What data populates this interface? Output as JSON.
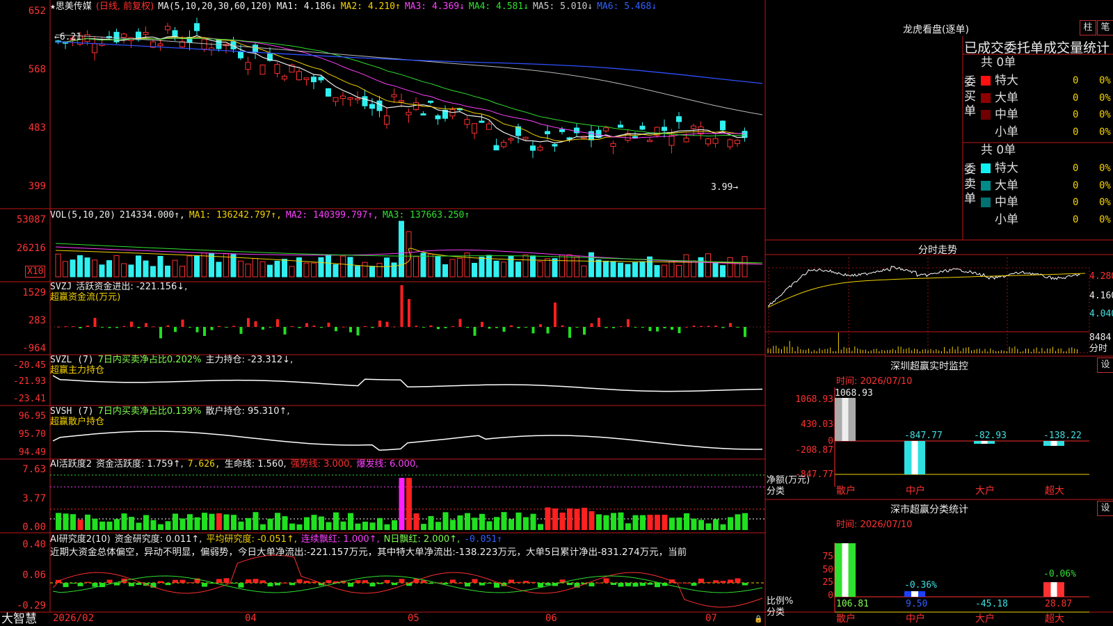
{
  "stock": {
    "name": "思美传媒",
    "period": "(日线, 前复权)",
    "ma_label": "MA(5,10,20,30,60,120)",
    "ma_values": [
      {
        "label": "MA1:",
        "value": "4.186",
        "arrow": "↓",
        "color": "#eeeeee"
      },
      {
        "label": "MA2:",
        "value": "4.210",
        "arrow": "↑",
        "color": "#f5d300"
      },
      {
        "label": "MA3:",
        "value": "4.369",
        "arrow": "↓",
        "color": "#ff40ff"
      },
      {
        "label": "MA4:",
        "value": "4.581",
        "arrow": "↓",
        "color": "#30e030"
      },
      {
        "label": "MA5:",
        "value": "5.010",
        "arrow": "↓",
        "color": "#cccccc"
      },
      {
        "label": "MA6:",
        "value": "5.468",
        "arrow": "↓",
        "color": "#3060ff"
      }
    ],
    "price_axis": [
      "652",
      "568",
      "483",
      "399"
    ],
    "high_label": "6.21",
    "low_label": "3.99→"
  },
  "vol": {
    "label": "VOL(5,10,20)",
    "value": "214334.000↑,",
    "ma1": "MA1: 136242.797↑,",
    "ma2": "MA2: 140399.797↑,",
    "ma3": "MA3: 137663.250↑",
    "axis": [
      "53087",
      "26216"
    ],
    "unit": "X10"
  },
  "svzj": {
    "label": "SVZJ",
    "desc": "活跃资金进出: -221.156↓,",
    "sub": "超赢资金流(万元)",
    "axis": [
      "1529",
      "283",
      "-964"
    ]
  },
  "svzl": {
    "label": "SVZL (7)",
    "desc": "7日内买卖净占比0.202%",
    "hold": "主力持仓: -23.312↓,",
    "sub": "超赢主力持仓",
    "axis": [
      "-20.45",
      "-21.93",
      "-23.41"
    ]
  },
  "svsh": {
    "label": "SVSH (7)",
    "desc": "7日内买卖净占比0.139%",
    "hold": "散户持仓: 95.310↑,",
    "sub": "超赢散户持仓",
    "axis": [
      "96.95",
      "95.70",
      "94.49"
    ]
  },
  "ai1": {
    "label": "AI活跃度2",
    "a": "资金活跃度: 1.759↑,",
    "b": "7.626,",
    "c": "生命线: 1.560,",
    "d": "强势线: 3.000,",
    "e": "爆发线: 6.000,",
    "axis": [
      "7.63",
      "3.77",
      "0.00"
    ]
  },
  "ai2": {
    "label": "AI研究度2(10)",
    "a": "资金研究度: 0.011↑,",
    "b": "平均研究度: -0.051↑,",
    "c": "连续飘红: 1.000↑,",
    "d": "N日飘红: 2.000↑,",
    "e": "-0.051↑",
    "comment": "近期大资金总体偏空，异动不明显，偏弱势，今日大单净流出:-221.157万元，其中特大单净流出:-138.223万元，大单5日累计净出-831.274万元，当前",
    "axis": [
      "0.40",
      "0.06",
      "-0.29"
    ]
  },
  "xaxis": {
    "brand": "大智慧",
    "labels": [
      "2026/02",
      "04",
      "05",
      "06",
      "07"
    ]
  },
  "lhb": {
    "title": "龙虎看盘(逐单)",
    "btn1": "柱",
    "btn2": "笔",
    "subtitle": "已成交委托单成交量统计",
    "buy_side": "委买单",
    "sell_side": "委卖单",
    "buy_total": "共 0单",
    "sell_total": "共 0单",
    "buy_rows": [
      {
        "label": "特大",
        "value": "0",
        "pct": "0%",
        "color": "#ff1010"
      },
      {
        "label": "大单",
        "value": "0",
        "pct": "0%",
        "color": "#900000"
      },
      {
        "label": "中单",
        "value": "0",
        "pct": "0%",
        "color": "#700000"
      },
      {
        "label": "小单",
        "value": "0",
        "pct": "0%",
        "color": "#000000"
      }
    ],
    "sell_rows": [
      {
        "label": "特大",
        "value": "0",
        "pct": "0%",
        "color": "#10f0f0"
      },
      {
        "label": "大单",
        "value": "0",
        "pct": "0%",
        "color": "#008a8a"
      },
      {
        "label": "中单",
        "value": "0",
        "pct": "0%",
        "color": "#007070"
      },
      {
        "label": "小单",
        "value": "0",
        "pct": "0%",
        "color": "#000000"
      }
    ]
  },
  "intraday": {
    "title": "分时走势",
    "axis": [
      "4.280",
      "4.160",
      "4.040"
    ],
    "vol": "8484",
    "unit": "分时"
  },
  "monitor": {
    "title": "深圳超赢实时监控",
    "btn": "设",
    "time": "时间: 2026/07/10",
    "axis": [
      "1068.93",
      "430.03",
      "0",
      "-208.87",
      "-847.77"
    ],
    "ylabel1": "净额(万元)",
    "ylabel2": "分类",
    "cats": [
      "散户",
      "中户",
      "大户",
      "超大"
    ],
    "values": [
      "1068.93",
      "-847.77",
      "-82.93",
      "-138.22"
    ]
  },
  "classify": {
    "title": "深市超赢分类统计",
    "btn": "设",
    "time": "时间: 2026/07/10",
    "axis": [
      "75",
      "50",
      "25",
      "0"
    ],
    "ylabel1": "比例%",
    "ylabel2": "分类",
    "cats": [
      "散户",
      "中户",
      "大户",
      "超大"
    ],
    "bar_pcts": [
      "-0.36%",
      "-0.06%"
    ],
    "values": [
      "106.81",
      "9.50",
      "-45.18",
      "28.87"
    ]
  }
}
